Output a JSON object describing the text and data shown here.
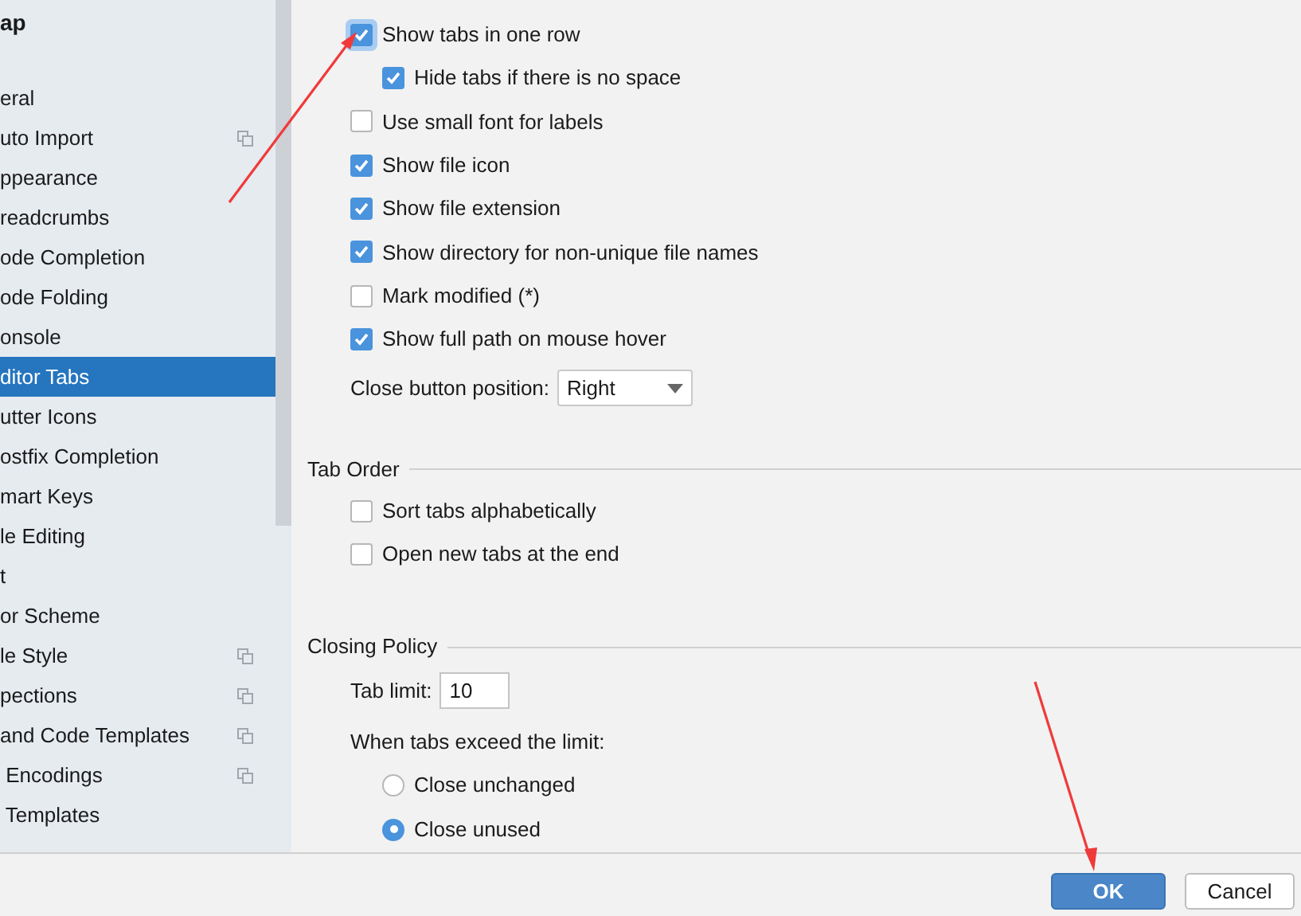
{
  "sidebar": {
    "title": "ap",
    "items": [
      {
        "label": "eral",
        "selected": false,
        "children": [
          {
            "label": "uto Import",
            "selected": false,
            "shared": true
          },
          {
            "label": "ppearance",
            "selected": false,
            "shared": false
          },
          {
            "label": "readcrumbs",
            "selected": false,
            "shared": false
          },
          {
            "label": "ode Completion",
            "selected": false,
            "shared": false
          },
          {
            "label": "ode Folding",
            "selected": false,
            "shared": false
          },
          {
            "label": "onsole",
            "selected": false,
            "shared": false
          },
          {
            "label": "ditor Tabs",
            "selected": true,
            "shared": false
          },
          {
            "label": "utter Icons",
            "selected": false,
            "shared": false
          },
          {
            "label": "ostfix Completion",
            "selected": false,
            "shared": false
          },
          {
            "label": "mart Keys",
            "selected": false,
            "shared": false
          }
        ]
      },
      {
        "label": "le Editing",
        "selected": false,
        "shared": false
      },
      {
        "label": "t",
        "selected": false,
        "shared": false
      },
      {
        "label": "or Scheme",
        "selected": false,
        "shared": false
      },
      {
        "label": "le Style",
        "selected": false,
        "shared": true
      },
      {
        "label": "pections",
        "selected": false,
        "shared": true
      },
      {
        "label": "and Code Templates",
        "selected": false,
        "shared": true
      },
      {
        "label": " Encodings",
        "selected": false,
        "shared": true
      },
      {
        "label": " Templates",
        "selected": false,
        "shared": false
      }
    ]
  },
  "appearance": {
    "options": [
      {
        "label": "Show tabs in one row",
        "checked": true,
        "focused": true,
        "indented": false
      },
      {
        "label": "Hide tabs if there is no space",
        "checked": true,
        "focused": false,
        "indented": true
      },
      {
        "label": "Use small font for labels",
        "checked": false,
        "focused": false,
        "indented": false
      },
      {
        "label": "Show file icon",
        "checked": true,
        "focused": false,
        "indented": false
      },
      {
        "label": "Show file extension",
        "checked": true,
        "focused": false,
        "indented": false
      },
      {
        "label": "Show directory for non-unique file names",
        "checked": true,
        "focused": false,
        "indented": false
      },
      {
        "label": "Mark modified (*)",
        "checked": false,
        "focused": false,
        "indented": false
      },
      {
        "label": "Show full path on mouse hover",
        "checked": true,
        "focused": false,
        "indented": false
      }
    ],
    "close_button_position": {
      "label": "Close button position:",
      "value": "Right"
    }
  },
  "tab_order": {
    "title": "Tab Order",
    "options": [
      {
        "label": "Sort tabs alphabetically",
        "checked": false
      },
      {
        "label": "Open new tabs at the end",
        "checked": false
      }
    ]
  },
  "closing_policy": {
    "title": "Closing Policy",
    "tab_limit": {
      "label": "Tab limit:",
      "value": "10"
    },
    "exceed_label": "When tabs exceed the limit:",
    "choices": [
      {
        "label": "Close unchanged",
        "selected": false
      },
      {
        "label": "Close unused",
        "selected": true
      }
    ]
  },
  "buttons": [
    {
      "label": "OK",
      "kind": "primary"
    },
    {
      "label": "Cancel",
      "kind": "secondary"
    }
  ]
}
